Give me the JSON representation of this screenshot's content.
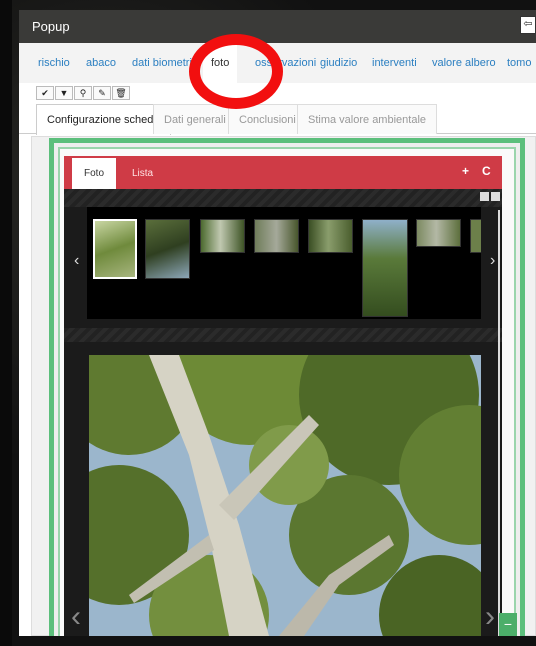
{
  "window": {
    "title": "Popup",
    "exit_icon": "exit-icon"
  },
  "nav": {
    "items": [
      {
        "label": "rischio"
      },
      {
        "label": "abaco"
      },
      {
        "label": "dati biometrici"
      },
      {
        "label": "foto"
      },
      {
        "label": "osservazioni"
      },
      {
        "label": "giudizio"
      },
      {
        "label": "interventi"
      },
      {
        "label": "valore albero"
      },
      {
        "label": "tomo"
      }
    ],
    "active": "foto"
  },
  "toolbar": {
    "icons": [
      "check-icon",
      "filter-icon",
      "zoom-icon",
      "edit-icon",
      "trash-icon"
    ],
    "glyphs": [
      "✔",
      "▼",
      "⚲",
      "✎",
      "🗑"
    ]
  },
  "tabs": [
    {
      "label": "Configurazione scheda"
    },
    {
      "label": "Dati generali"
    },
    {
      "label": "Conclusioni"
    },
    {
      "label": "Stima valore ambientale"
    }
  ],
  "photo_panel": {
    "tab_foto": "Foto",
    "tab_lista": "Lista",
    "add_icon": "+",
    "refresh_icon": "C",
    "prev_icon": "‹",
    "next_icon": "›",
    "big_prev": "‹",
    "big_next": "›"
  },
  "colors": {
    "header_red": "#cf3b46",
    "frame_green": "#5cbf7c",
    "link_blue": "#2b7fc1",
    "highlight_red": "#f20f0f"
  }
}
